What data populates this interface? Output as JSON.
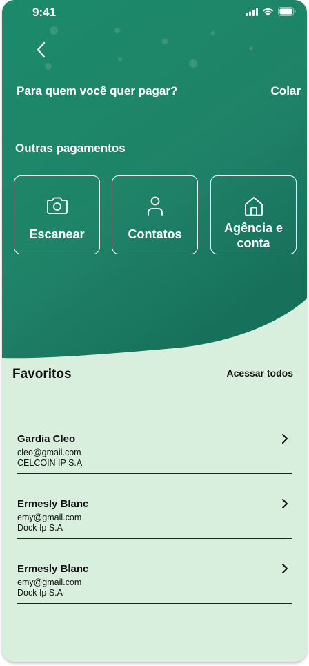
{
  "status": {
    "time": "9:41"
  },
  "header": {
    "question": "Para quem você quer pagar?",
    "paste_label": "Colar",
    "others_title": "Outras pagamentos"
  },
  "options": [
    {
      "label": "Escanear",
      "icon": "camera-icon"
    },
    {
      "label": "Contatos",
      "icon": "user-icon"
    },
    {
      "label_line1": "Agência e",
      "label_line2": "conta",
      "icon": "home-icon"
    }
  ],
  "favorites": {
    "title": "Favoritos",
    "see_all": "Acessar todos",
    "items": [
      {
        "name": "Gardia Cleo",
        "email": "cleo@gmail.com",
        "bank": "CELCOIN IP S.A"
      },
      {
        "name": "Ermesly Blanc",
        "email": "emy@gmail.com",
        "bank": "Dock Ip S.A"
      },
      {
        "name": "Ermesly Blanc",
        "email": "emy@gmail.com",
        "bank": "Dock Ip S.A"
      }
    ]
  },
  "colors": {
    "primary": "#1f8366",
    "light_bg": "#d9efde"
  }
}
